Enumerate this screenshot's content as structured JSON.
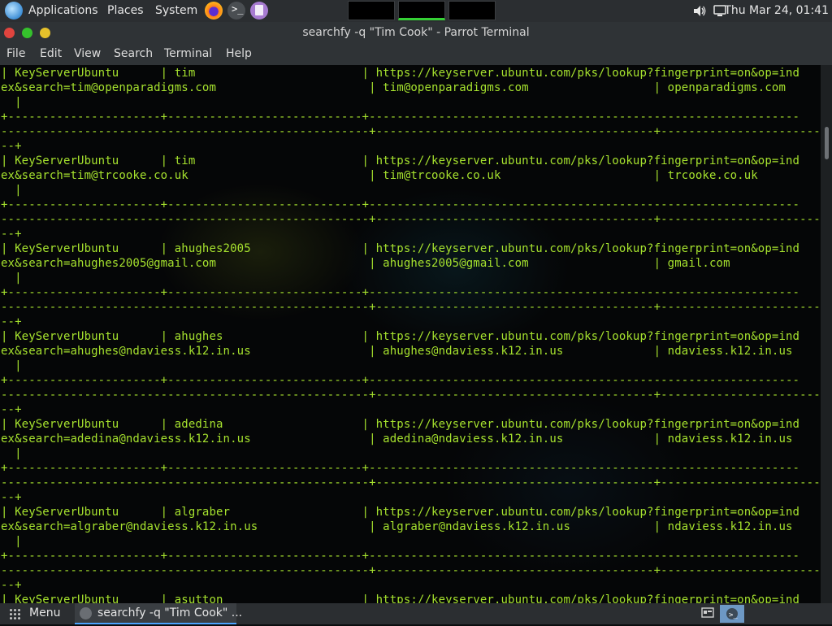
{
  "top_panel": {
    "menus": [
      "Applications",
      "Places",
      "System"
    ],
    "clock": "Thu Mar 24, 01:41"
  },
  "window": {
    "title": "searchfy -q \"Tim Cook\" - Parrot Terminal"
  },
  "menu_bar": [
    "File",
    "Edit",
    "View",
    "Search",
    "Terminal",
    "Help"
  ],
  "terminal": {
    "lines": [
      "| KeyServerUbuntu      | tim                        | https://keyserver.ubuntu.com/pks/lookup?fingerprint=on&op=ind",
      "ex&search=tim@openparadigms.com                      | tim@openparadigms.com                  | openparadigms.com",
      "  |",
      "+----------------------+----------------------------+--------------------------------------------------------------",
      "-----------------------------------------------------+----------------------------------------+-----------------------",
      "--+",
      "| KeyServerUbuntu      | tim                        | https://keyserver.ubuntu.com/pks/lookup?fingerprint=on&op=ind",
      "ex&search=tim@trcooke.co.uk                          | tim@trcooke.co.uk                      | trcooke.co.uk",
      "  |",
      "+----------------------+----------------------------+--------------------------------------------------------------",
      "-----------------------------------------------------+----------------------------------------+-----------------------",
      "--+",
      "| KeyServerUbuntu      | ahughes2005                | https://keyserver.ubuntu.com/pks/lookup?fingerprint=on&op=ind",
      "ex&search=ahughes2005@gmail.com                      | ahughes2005@gmail.com                  | gmail.com",
      "  |",
      "+----------------------+----------------------------+--------------------------------------------------------------",
      "-----------------------------------------------------+----------------------------------------+-----------------------",
      "--+",
      "| KeyServerUbuntu      | ahughes                    | https://keyserver.ubuntu.com/pks/lookup?fingerprint=on&op=ind",
      "ex&search=ahughes@ndaviess.k12.in.us                 | ahughes@ndaviess.k12.in.us             | ndaviess.k12.in.us",
      "  |",
      "+----------------------+----------------------------+--------------------------------------------------------------",
      "-----------------------------------------------------+----------------------------------------+-----------------------",
      "--+",
      "| KeyServerUbuntu      | adedina                    | https://keyserver.ubuntu.com/pks/lookup?fingerprint=on&op=ind",
      "ex&search=adedina@ndaviess.k12.in.us                 | adedina@ndaviess.k12.in.us             | ndaviess.k12.in.us",
      "  |",
      "+----------------------+----------------------------+--------------------------------------------------------------",
      "-----------------------------------------------------+----------------------------------------+-----------------------",
      "--+",
      "| KeyServerUbuntu      | algraber                   | https://keyserver.ubuntu.com/pks/lookup?fingerprint=on&op=ind",
      "ex&search=algraber@ndaviess.k12.in.us                | algraber@ndaviess.k12.in.us            | ndaviess.k12.in.us",
      "  |",
      "+----------------------+----------------------------+--------------------------------------------------------------",
      "-----------------------------------------------------+----------------------------------------+-----------------------",
      "--+",
      "| KeyServerUbuntu      | asutton                    | https://keyserver.ubuntu.com/pks/lookup?fingerprint=on&op=ind"
    ]
  },
  "taskbar": {
    "menu_label": "Menu",
    "task_label": "searchfy -q \"Tim Cook\" ..."
  },
  "colors": {
    "terminal_text": "#a6e22e",
    "close": "#e0443e",
    "minimize": "#35c12c",
    "maximize": "#e5c12b"
  }
}
